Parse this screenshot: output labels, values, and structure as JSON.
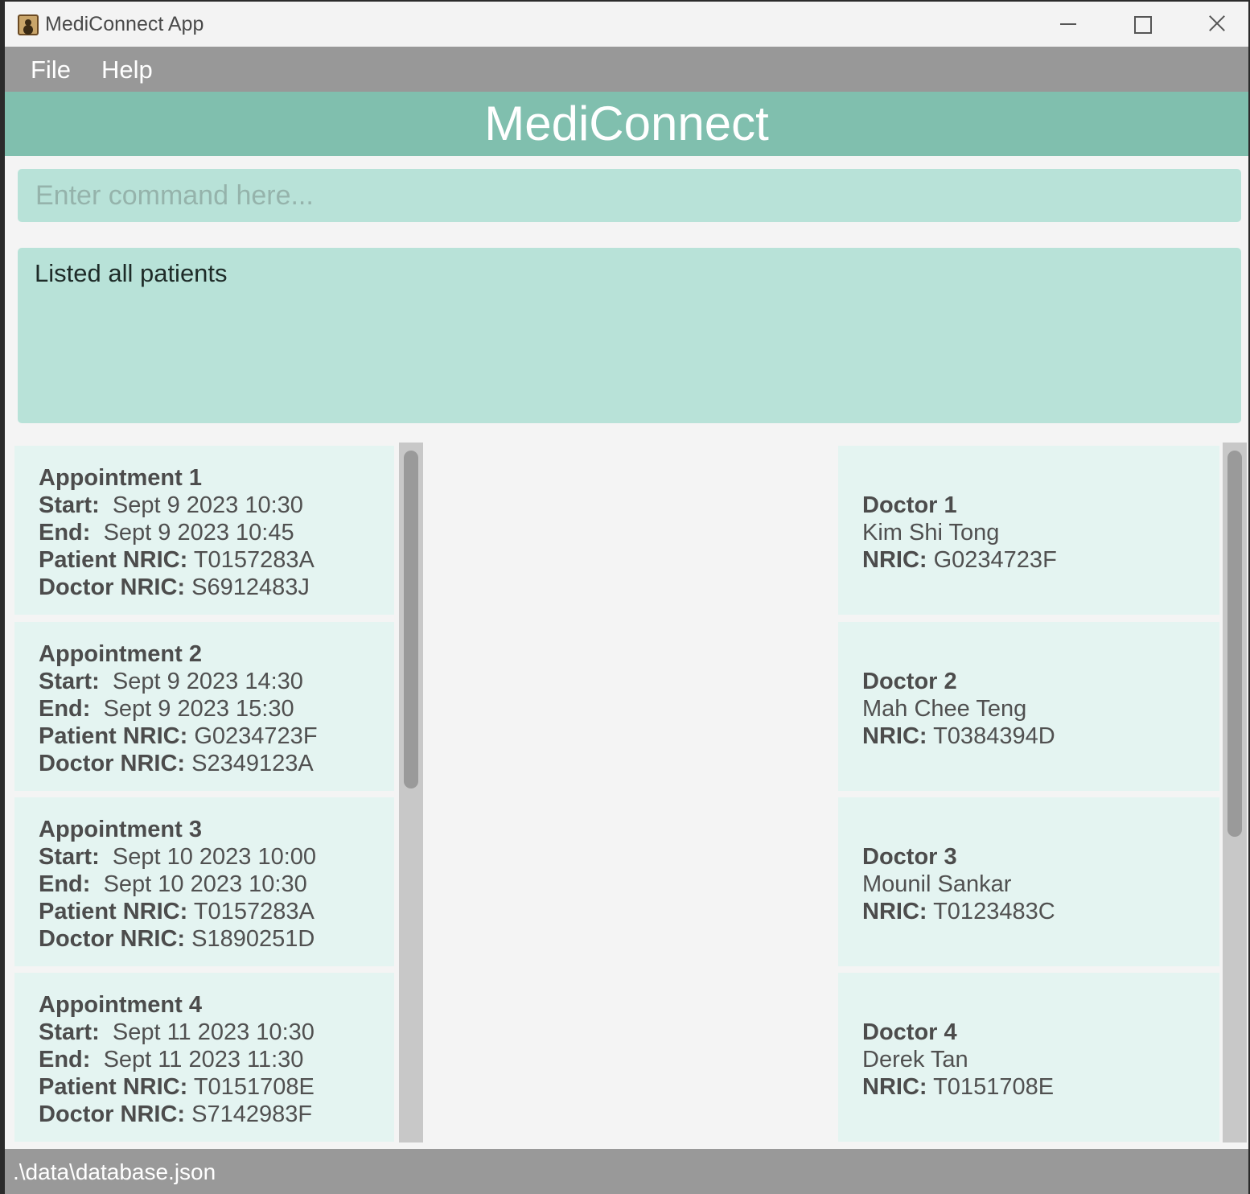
{
  "window": {
    "title": "MediConnect App"
  },
  "menu": {
    "file": "File",
    "help": "Help"
  },
  "header": {
    "title": "MediConnect"
  },
  "command": {
    "placeholder": "Enter command here..."
  },
  "result": {
    "text": "Listed all patients"
  },
  "appointments": [
    {
      "title": "Appointment 1",
      "start_label": "Start:",
      "start": "Sept 9 2023 10:30",
      "end_label": "End:",
      "end": "Sept 9 2023 10:45",
      "patient_label": "Patient NRIC:",
      "patient_nric": "T0157283A",
      "doctor_label": "Doctor NRIC:",
      "doctor_nric": "S6912483J"
    },
    {
      "title": "Appointment 2",
      "start_label": "Start:",
      "start": "Sept 9 2023 14:30",
      "end_label": "End:",
      "end": "Sept 9 2023 15:30",
      "patient_label": "Patient NRIC:",
      "patient_nric": "G0234723F",
      "doctor_label": "Doctor NRIC:",
      "doctor_nric": "S2349123A"
    },
    {
      "title": "Appointment 3",
      "start_label": "Start:",
      "start": "Sept 10 2023 10:00",
      "end_label": "End:",
      "end": "Sept 10 2023 10:30",
      "patient_label": "Patient NRIC:",
      "patient_nric": "T0157283A",
      "doctor_label": "Doctor NRIC:",
      "doctor_nric": "S1890251D"
    },
    {
      "title": "Appointment 4",
      "start_label": "Start:",
      "start": "Sept 11 2023 10:30",
      "end_label": "End:",
      "end": "Sept 11 2023 11:30",
      "patient_label": "Patient NRIC:",
      "patient_nric": "T0151708E",
      "doctor_label": "Doctor NRIC:",
      "doctor_nric": "S7142983F"
    }
  ],
  "doctors": [
    {
      "title": "Doctor 1",
      "name": "Kim Shi Tong",
      "nric_label": "NRIC:",
      "nric": "G0234723F"
    },
    {
      "title": "Doctor 2",
      "name": "Mah Chee Teng",
      "nric_label": "NRIC:",
      "nric": "T0384394D"
    },
    {
      "title": "Doctor 3",
      "name": "Mounil Sankar",
      "nric_label": "NRIC:",
      "nric": "T0123483C"
    },
    {
      "title": "Doctor 4",
      "name": "Derek Tan",
      "nric_label": "NRIC:",
      "nric": "T0151708E"
    }
  ],
  "status": {
    "path": ".\\data\\database.json"
  },
  "colors": {
    "header": "#80bfae",
    "input_bg": "#b8e2d8",
    "card_bg": "#e4f4f1",
    "menubar": "#989898"
  },
  "icons": {
    "app": "address-book-icon",
    "minimize": "minimize-icon",
    "maximize": "maximize-icon",
    "close": "close-icon"
  }
}
